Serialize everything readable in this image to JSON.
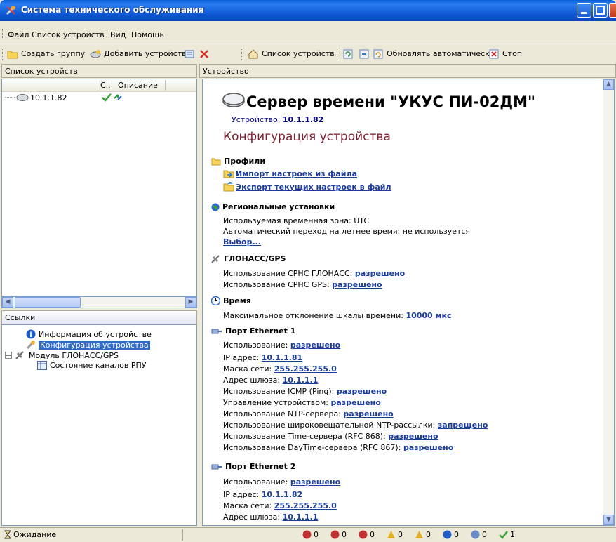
{
  "window": {
    "title": "Система технического обслуживания"
  },
  "menu": [
    "Файл",
    "Список устройств",
    "Вид",
    "Помощь"
  ],
  "toolbar": {
    "create_group": "Создать группу",
    "add_device": "Добавить устройство",
    "device_list": "Список устройств",
    "auto_refresh": "Обновлять автоматически",
    "stop": "Стоп"
  },
  "left": {
    "header": "Список устройств",
    "columns": [
      "С..",
      "Описание"
    ],
    "devices": [
      {
        "name": "10.1.1.82"
      }
    ]
  },
  "links": {
    "header": "Ссылки",
    "items": [
      "Информация об устройстве",
      "Конфигурация устройства",
      "Модуль ГЛОНАСС/GPS",
      "Состояние каналов РПУ"
    ]
  },
  "right": {
    "header": "Устройство",
    "title": "Сервер времени \"УКУС ПИ-02ДМ\"",
    "device_label": "Устройство:",
    "device_ip": "10.1.1.82",
    "subtitle": "Конфигурация устройства",
    "profiles": {
      "title": "Профили",
      "import": "Импорт настроек из файла",
      "export": "Экспорт текущих настроек в файл"
    },
    "regional": {
      "title": "Региональные установки",
      "timezone": "Используемая временная зона: UTC",
      "dst": "Автоматический переход на летнее время: не используется",
      "choose": "Выбор..."
    },
    "gnss": {
      "title": "ГЛОНАСС/GPS",
      "glonass_label": "Использование СРНС ГЛОНАСС:",
      "glonass_val": "разрешено",
      "gps_label": "Использование СРНС GPS:",
      "gps_val": "разрешено"
    },
    "time": {
      "title": "Время",
      "dev_label": "Максимальное отклонение шкалы времени:",
      "dev_val": "10000 мкс"
    },
    "eth1": {
      "title": "Порт Ethernet 1",
      "rows": [
        {
          "label": "Использование:",
          "value": "разрешено"
        },
        {
          "label": "IP адрес:",
          "value": "10.1.1.81"
        },
        {
          "label": "Маска сети:",
          "value": "255.255.255.0"
        },
        {
          "label": "Адрес шлюза:",
          "value": "10.1.1.1"
        },
        {
          "label": "Использование ICMP (Ping):",
          "value": "разрешено"
        },
        {
          "label": "Управление устройством:",
          "value": "разрешено"
        },
        {
          "label": "Использование NTP-сервера:",
          "value": "разрешено"
        },
        {
          "label": "Использование широковещательной NTP-рассылки:",
          "value": "запрещено"
        },
        {
          "label": "Использование Time-сервера (RFC 868):",
          "value": "разрешено"
        },
        {
          "label": "Использование DayTime-сервера (RFC 867):",
          "value": "разрешено"
        }
      ]
    },
    "eth2": {
      "title": "Порт Ethernet 2",
      "rows": [
        {
          "label": "Использование:",
          "value": "разрешено"
        },
        {
          "label": "IP адрес:",
          "value": "10.1.1.82"
        },
        {
          "label": "Маска сети:",
          "value": "255.255.255.0"
        },
        {
          "label": "Адрес шлюза:",
          "value": "10.1.1.1"
        }
      ]
    }
  },
  "status": {
    "text": "Ожидание",
    "counters": [
      "0",
      "0",
      "0",
      "0",
      "0",
      "0",
      "0",
      "1"
    ]
  }
}
